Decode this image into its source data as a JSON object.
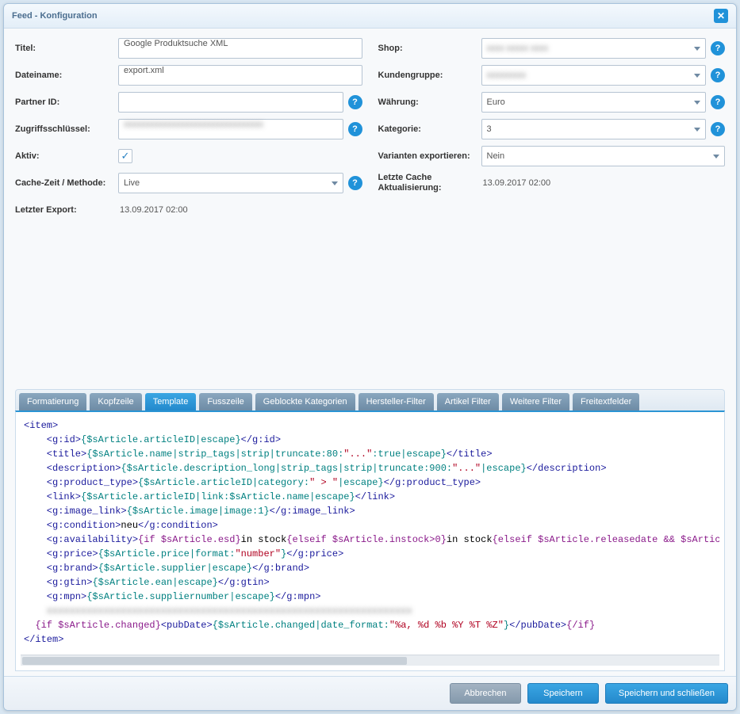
{
  "window": {
    "title": "Feed - Konfiguration"
  },
  "left": {
    "titel_label": "Titel:",
    "titel_value": "Google Produktsuche XML",
    "datei_label": "Dateiname:",
    "datei_value": "export.xml",
    "partner_label": "Partner ID:",
    "partner_value": "",
    "schluessel_label": "Zugriffsschlüssel:",
    "schluessel_value": "xxxxxxxxxxxxxxxxxxxxxxxxxxxxxxxx",
    "aktiv_label": "Aktiv:",
    "cache_label": "Cache-Zeit / Methode:",
    "cache_value": "Live",
    "export_label": "Letzter Export:",
    "export_value": "13.09.2017 02:00"
  },
  "right": {
    "shop_label": "Shop:",
    "shop_value": "xxxx xxxxx xxxx",
    "gruppe_label": "Kundengruppe:",
    "gruppe_value": "xxxxxxxxx",
    "waehrung_label": "Währung:",
    "waehrung_value": "Euro",
    "kat_label": "Kategorie:",
    "kat_value": "3",
    "var_label": "Varianten exportieren:",
    "var_value": "Nein",
    "cachets_label": "Letzte Cache Aktualisierung:",
    "cachets_value": "13.09.2017 02:00"
  },
  "tabs": {
    "t0": "Formatierung",
    "t1": "Kopfzeile",
    "t2": "Template",
    "t3": "Fusszeile",
    "t4": "Geblockte Kategorien",
    "t5": "Hersteller-Filter",
    "t6": "Artikel Filter",
    "t7": "Weitere Filter",
    "t8": "Freitextfelder"
  },
  "editor": {
    "l01a": "<item>",
    "l02a": "    <g:id>",
    "l02b": "{$sArticle.articleID|escape}",
    "l02c": "</g:id>",
    "l03a": "    <title>",
    "l03b": "{$sArticle.name|strip_tags|strip|truncate:80:",
    "l03c": "\"...\"",
    "l03d": ":true|escape}",
    "l03e": "</title>",
    "l04a": "    <description>",
    "l04b": "{$sArticle.description_long|strip_tags|strip|truncate:900:",
    "l04c": "\"...\"",
    "l04d": "|escape}",
    "l04e": "</description>",
    "l05a": "    <g:product_type>",
    "l05b": "{$sArticle.articleID|category:",
    "l05c": "\" > \"",
    "l05d": "|escape}",
    "l05e": "</g:product_type>",
    "l06a": "    <link>",
    "l06b": "{$sArticle.articleID|link:$sArticle.name|escape}",
    "l06c": "</link>",
    "l07a": "    <g:image_link>",
    "l07b": "{$sArticle.image|image:1}",
    "l07c": "</g:image_link>",
    "l08a": "    <g:condition>",
    "l08b": "neu",
    "l08c": "</g:condition>",
    "l09a": "    <g:availability>",
    "l09b": "{if $sArticle.esd}",
    "l09c": "in stock",
    "l09d": "{elseif $sArticle.instock>0}",
    "l09e": "in stock",
    "l09f": "{elseif $sArticle.releasedate && $sArticle.releas",
    "l10a": "    <g:price>",
    "l10b": "{$sArticle.price|format:",
    "l10c": "\"number\"",
    "l10d": "}",
    "l10e": "</g:price>",
    "l11a": "    <g:brand>",
    "l11b": "{$sArticle.supplier|escape}",
    "l11c": "</g:brand>",
    "l12a": "    <g:gtin>",
    "l12b": "{$sArticle.ean|escape}",
    "l12c": "</g:gtin>",
    "l13a": "    <g:mpn>",
    "l13b": "{$sArticle.suppliernumber|escape}",
    "l13c": "</g:mpn>",
    "l14": "    xxxxxxxxxxxxxxxxxxxxxxxxxxxxxxxxxxxxxxxxxxxxxxxxxxxxxxxxxxxxxxxx",
    "l15a": "  {if $sArticle.changed}",
    "l15b": "<pubDate>",
    "l15c": "{$sArticle.changed|date_format:",
    "l15d": "\"%a, %d %b %Y %T %Z\"",
    "l15e": "}",
    "l15f": "</pubDate>",
    "l15g": "{/if}",
    "l16": "</item>"
  },
  "footer": {
    "cancel": "Abbrechen",
    "save": "Speichern",
    "save_close": "Speichern und schließen"
  }
}
